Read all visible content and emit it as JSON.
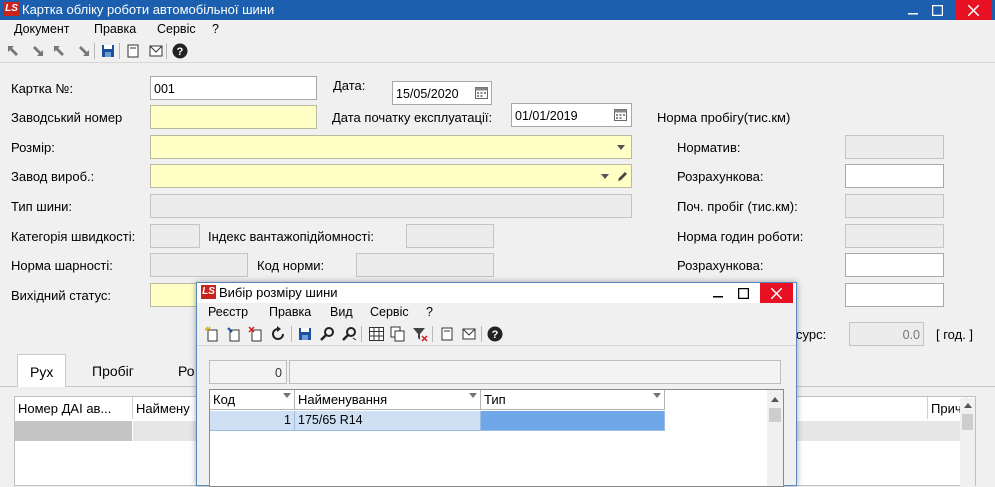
{
  "window": {
    "title": "Картка обліку роботи автомобільної шини",
    "logo": "LS",
    "accent": "#1b5fae"
  },
  "menu": [
    "Документ",
    "Правка",
    "Сервіс",
    "?"
  ],
  "form": {
    "card_no_label": "Картка №:",
    "card_no_value": "001",
    "date_label": "Дата:",
    "date_value": "15/05/2020",
    "serial_label": "Заводський номер",
    "serial_value": "",
    "start_date_label": "Дата початку експлуатації:",
    "start_date_value": "01/01/2019",
    "mileage_norm_label": "Норма пробігу(тис.км)",
    "size_label": "Розмір:",
    "size_value": "",
    "manufacturer_label": "Завод вироб.:",
    "manufacturer_value": "",
    "tire_type_label": "Тип шини:",
    "tire_type_value": "",
    "speed_category_label": "Категорія швидкості:",
    "load_index_label": "Індекс вантажопідйомності:",
    "pressure_norm_label": "Норма шарності:",
    "norm_code_label": "Код норми:",
    "output_status_label": "Вихідний статус:",
    "normative_label": "Норматив:",
    "calculated_label": "Розрахункова:",
    "initial_mileage_label": "Поч. пробіг (тис.км):",
    "work_hours_norm_label": "Норма годин роботи:",
    "calculated2_label": "Розрахункова:",
    "resource_label": "сурс:",
    "resource_value": "0.0",
    "resource_unit": "[ год. ]"
  },
  "tabs": [
    {
      "label": "Рух",
      "active": true
    },
    {
      "label": "Пробіг",
      "active": false
    },
    {
      "label": "Ро",
      "active": false
    }
  ],
  "main_grid": {
    "columns": [
      "Номер ДАІ ав...",
      "Наймену",
      "Прич"
    ]
  },
  "dialog": {
    "title": "Вибір розміру шини",
    "logo": "LS",
    "menu": [
      "Реєстр",
      "Правка",
      "Вид",
      "Сервіс",
      "?"
    ],
    "filter_value": "0",
    "columns": [
      "Код",
      "Найменування",
      "Тип"
    ],
    "rows": [
      {
        "code": "1",
        "name": "175/65 R14",
        "type": ""
      }
    ],
    "selection_color": "#cfe0f5",
    "selected_cell_color": "#6fa8e8"
  }
}
